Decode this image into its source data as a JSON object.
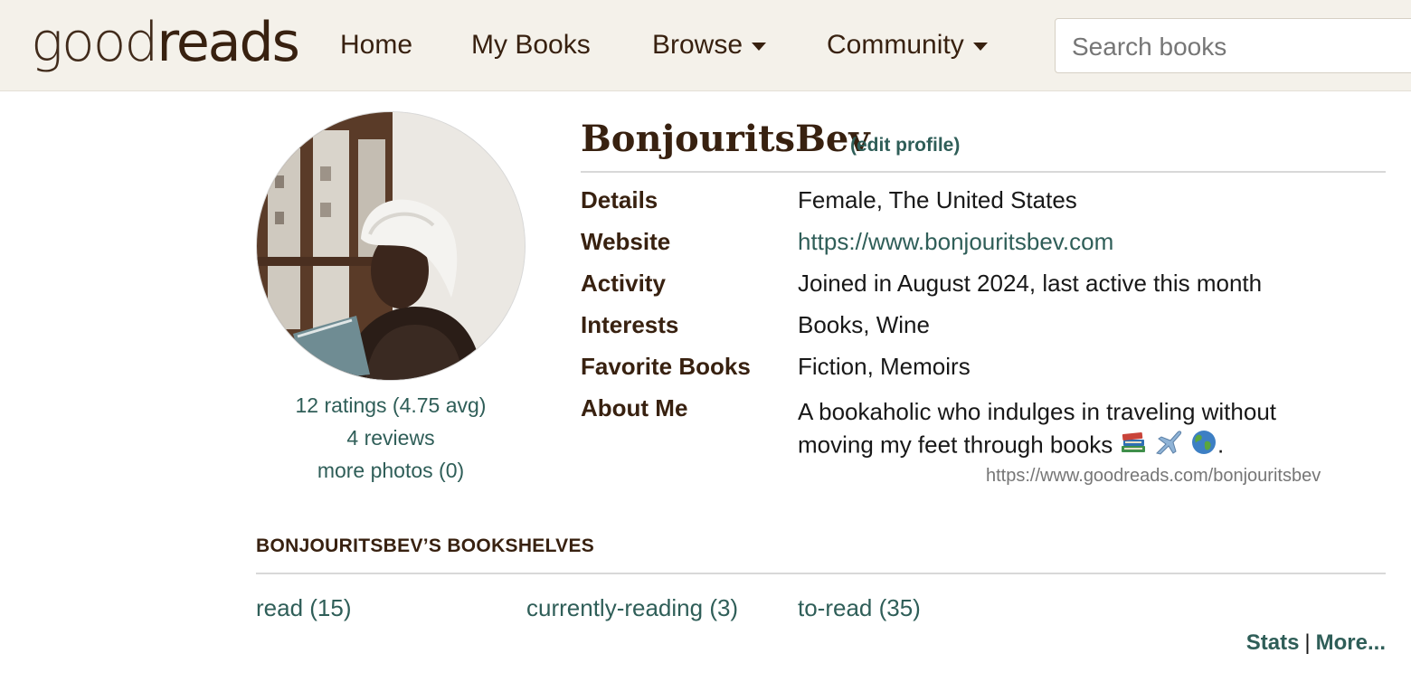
{
  "header": {
    "logo_good": "good",
    "logo_reads": "reads",
    "nav": {
      "home": "Home",
      "my_books": "My Books",
      "browse": "Browse",
      "community": "Community"
    },
    "search_placeholder": "Search books"
  },
  "profile": {
    "username": "BonjouritsBev",
    "edit_link": "(edit profile)",
    "stats": {
      "ratings": "12 ratings (4.75 avg)",
      "reviews": "4 reviews",
      "photos": "more photos (0)"
    },
    "details": [
      {
        "label": "Details",
        "value": "Female, The United States"
      },
      {
        "label": "Website",
        "value": "https://www.bonjouritsbev.com"
      },
      {
        "label": "Activity",
        "value": "Joined in August 2024, last active this month"
      },
      {
        "label": "Interests",
        "value": "Books, Wine"
      },
      {
        "label": "Favorite Books",
        "value": "Fiction, Memoirs"
      },
      {
        "label": "About Me",
        "value": "A bookaholic who indulges in traveling without moving my feet through books"
      }
    ],
    "about_emoji": [
      "books-emoji",
      "airplane-emoji",
      "globe-emoji"
    ],
    "about_end": ".",
    "profile_url": "https://www.goodreads.com/bonjouritsbev"
  },
  "bookshelves": {
    "title": "BONJOURITSBEV’S BOOKSHELVES",
    "shelves": [
      {
        "label": "read (15)"
      },
      {
        "label": "currently-reading (3)"
      },
      {
        "label": "to-read (35)"
      }
    ],
    "stats_link": "Stats",
    "separator": "|",
    "more_link": "More..."
  },
  "colors": {
    "brand_brown": "#382110",
    "link_green": "#2f5e58",
    "header_bg": "#f4f1ea"
  }
}
